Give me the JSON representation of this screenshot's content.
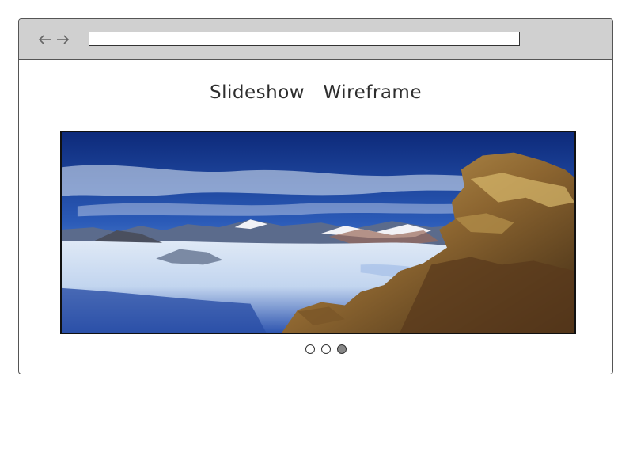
{
  "browser": {
    "address_bar": {
      "value": "",
      "placeholder": ""
    },
    "nav": {
      "back_icon": "arrow-left-icon",
      "forward_icon": "arrow-right-icon"
    }
  },
  "page": {
    "title": "Slideshow   Wireframe"
  },
  "slideshow": {
    "current_slide_image": "mountain-snowfield-landscape",
    "slide_count": 3,
    "active_slide_index": 2,
    "dot_colors": {
      "active": "#888888",
      "inactive": "#ffffff"
    }
  },
  "colors": {
    "toolbar": "#d0d0d0",
    "border": "#555555",
    "title_text": "#2e2e2e"
  }
}
